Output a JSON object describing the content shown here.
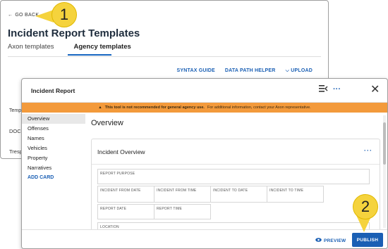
{
  "background_page": {
    "go_back": "GO BACK",
    "title": "Incident Report Templates",
    "tabs": [
      {
        "label": "Axon templates",
        "active": false
      },
      {
        "label": "Agency templates",
        "active": true
      }
    ],
    "actions": [
      "SYNTAX GUIDE",
      "DATA PATH HELPER",
      "UPLOAD"
    ],
    "left_rows": [
      "Temp",
      "DOCX",
      "Tresp"
    ]
  },
  "callouts": [
    "1",
    "2"
  ],
  "modal": {
    "title": "Incident Report",
    "header_icons": [
      "filter-list-icon",
      "more-horizontal-icon",
      "close-icon"
    ],
    "close_glyph": "✕",
    "more_glyph": "···",
    "warning": {
      "bold": "This tool is not recommended for general agency use.",
      "text": "For additional information, contact your Axon representative."
    },
    "sidebar": {
      "items": [
        "Overview",
        "Offenses",
        "Names",
        "Vehicles",
        "Property",
        "Narratives"
      ],
      "active_index": 0,
      "add_card": "ADD CARD"
    },
    "content": {
      "title": "Overview",
      "card": {
        "title": "Incident Overview",
        "more": "···",
        "fields": {
          "report_purpose": "REPORT PURPOSE",
          "incident_from_date": "INCIDENT FROM DATE",
          "incident_from_time": "INCIDENT FROM TIME",
          "incident_to_date": "INCIDENT TO DATE",
          "incident_to_time": "INCIDENT TO TIME",
          "report_date": "REPORT DATE",
          "report_time": "REPORT TIME",
          "location": "LOCATION"
        }
      }
    },
    "footer": {
      "preview": "PREVIEW",
      "publish": "PUBLISH"
    }
  },
  "colors": {
    "accent": "#1a5fb4",
    "warning": "#f39a3b",
    "callout": "#f5d33d"
  }
}
